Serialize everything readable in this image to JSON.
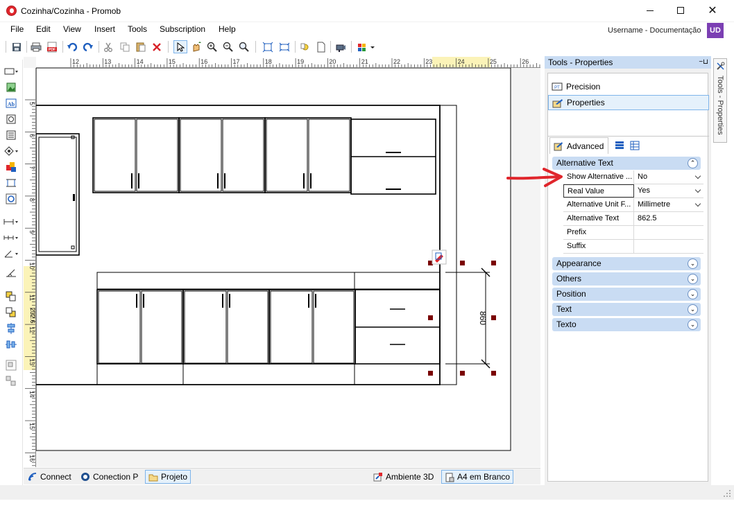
{
  "window": {
    "title": "Cozinha/Cozinha - Promob",
    "controls": {
      "minimize": "minimize",
      "maximize": "maximize",
      "close": "close"
    }
  },
  "menu": {
    "items": [
      "File",
      "Edit",
      "View",
      "Insert",
      "Tools",
      "Subscription",
      "Help"
    ],
    "user": "Username - Documentação",
    "avatar": "UD"
  },
  "toolbar": {
    "icons": [
      "save-icon",
      "print-icon",
      "pdf-icon",
      "undo-icon",
      "redo-icon",
      "cut-icon",
      "copy-icon",
      "paste-icon",
      "delete-icon",
      "select-icon",
      "pan-icon",
      "zoom-in-icon",
      "zoom-out-icon",
      "zoom-icon",
      "fit-icon",
      "fit-all-icon",
      "light-icon",
      "page-icon",
      "camera-icon",
      "color-icon"
    ],
    "pdf_label": "PDF"
  },
  "canvas": {
    "ruler_top_ticks": [
      "12",
      "13",
      "14",
      "15",
      "16",
      "17",
      "18",
      "19",
      "20",
      "21",
      "22",
      "23",
      "24",
      "25",
      "26"
    ],
    "ruler_left_ticks": [
      "5",
      "6",
      "7",
      "8",
      "9",
      "10",
      "11",
      "12",
      "13",
      "14",
      "15",
      "16"
    ],
    "ruler_left_marker": "232.6",
    "dimension_label": "860"
  },
  "bottom_tabs": {
    "left": [
      {
        "label": "Connect",
        "icon": "connect-icon"
      },
      {
        "label": "Conection P",
        "icon": "promob-icon"
      },
      {
        "label": "Projeto",
        "icon": "folder-icon"
      }
    ],
    "right": [
      {
        "label": "Ambiente 3D",
        "icon": "scene-3d-icon"
      },
      {
        "label": "A4 em Branco",
        "icon": "page-icon"
      }
    ]
  },
  "properties_panel": {
    "title": "Tools - Properties",
    "sections": [
      {
        "label": "Precision",
        "icon": "precision-icon"
      },
      {
        "label": "Properties",
        "icon": "properties-icon"
      }
    ],
    "tab": "Advanced",
    "categories": {
      "alternative_text": "Alternative Text",
      "appearance": "Appearance",
      "others": "Others",
      "position": "Position",
      "text": "Text",
      "texto": "Texto"
    },
    "rows": [
      {
        "label": "Show Alternative ...",
        "value": "No",
        "type": "combo"
      },
      {
        "label": "Real Value",
        "value": "Yes",
        "type": "combo"
      },
      {
        "label": "Alternative Unit F...",
        "value": "Millimetre",
        "type": "combo"
      },
      {
        "label": "Alternative Text",
        "value": "862.5",
        "type": "text"
      },
      {
        "label": "Prefix",
        "value": "",
        "type": "text"
      },
      {
        "label": "Suffix",
        "value": "",
        "type": "text"
      }
    ]
  },
  "side_tab": {
    "label": "Tools - Properties"
  },
  "annotation": {
    "color": "#e0262c"
  }
}
